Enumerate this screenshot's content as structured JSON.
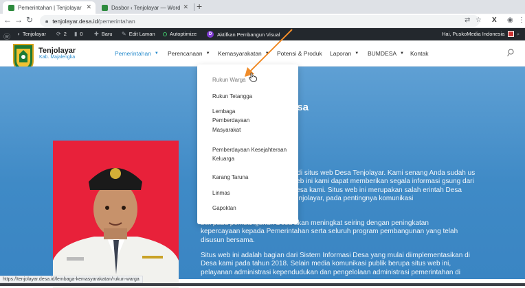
{
  "browser": {
    "tabs": [
      {
        "title": "Pemerintahan | Tenjolayar",
        "close": "✕"
      },
      {
        "title": "Dasbor ‹ Tenjolayar — WordPress",
        "close": "✕"
      }
    ],
    "new_tab": "+",
    "url_host": "tenjolayar.desa.id",
    "url_path": "/pemerintahan",
    "status_url": "https://tenjolayar.desa.id/lembaga-kemasyarakatan/rukun-warga"
  },
  "adminbar": {
    "site": "Tenjolayar",
    "updates": "2",
    "comments": "0",
    "new": "Baru",
    "edit": "Edit Laman",
    "autoptimize": "Autoptimize",
    "divi": "Aktifkan Pembangun Visual",
    "greeting": "Hai, PuskoMedia Indonesia"
  },
  "site": {
    "name": "Tenjolayar",
    "tagline": "Kab. Majalengka",
    "menu": [
      "Pemerintahan",
      "Perencanaan",
      "Kemasyarakatan",
      "Potensi & Produk",
      "Laporan",
      "BUMDESA",
      "Kontak"
    ]
  },
  "dropdown": [
    "Rukun Warga",
    "Rukun Tetangga",
    "Lembaga Pemberdayaan Masyarakat",
    "Pemberdayaan Kesejahteraan Keluarga",
    "Karang Taruna",
    "Linmas",
    "Gapoktan"
  ],
  "hero": {
    "title": "esa",
    "p1": "g di situs web Desa Tenjolayar. Kami senang Anda sudah us web ini kami dapat memberikan segala informasi gsung dari Desa kami. Situs web ini merupakan salah erintah Desa Tenjolayar, pada pentingnya komunikasi",
    "p2": "blik pada pembangunan Desa akan meningkat seiring dengan peningkatan kepercayaan kepada Pemerintahan serta seluruh program pembangunan yang telah disusun bersama.",
    "p3": "Situs web ini adalah bagian dari Sistem Informasi Desa yang mulai diimplementasikan di Desa kami pada tahun 2018. Selain media komunikasi publik berupa situs web ini, pelayanan administrasi kependudukan dan pengelolaan administrasi pemerintahan di"
  },
  "colors": {
    "accent": "#2a8ccc",
    "hero": "#3f8ac6",
    "adminbar": "#23282d",
    "photo_bg": "#e8213a",
    "annotation": "#f08c2a"
  }
}
